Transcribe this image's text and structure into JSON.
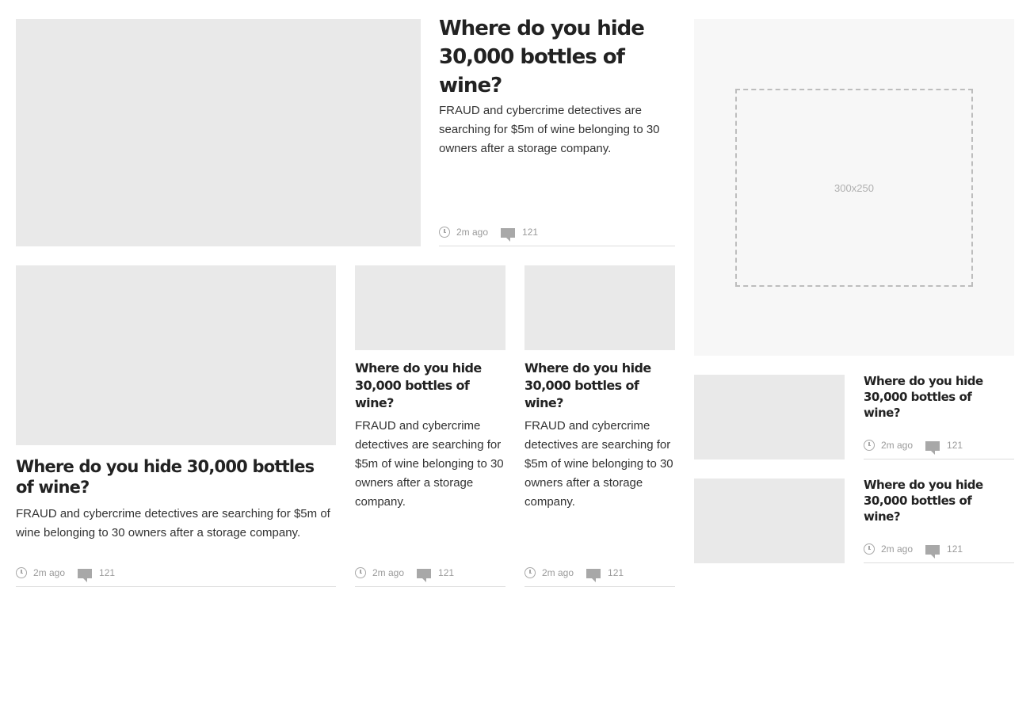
{
  "lead_story": {
    "headline": "Where do you hide 30,000 bottles of wine?",
    "standfirst": "FRAUD and cybercrime detectives are searching for $5m of wine belonging to 30 owners after a storage company.",
    "time": "2m ago",
    "comments": "121"
  },
  "feature_story": {
    "headline": "Where do you hide 30,000 bottles of wine?",
    "standfirst": "FRAUD and cybercrime detectives are searching for $5m of wine belonging to 30 owners after a storage company.",
    "time": "2m ago",
    "comments": "121"
  },
  "column_stories": [
    {
      "headline": "Where do you hide 30,000 bottles of wine?",
      "standfirst": "FRAUD and cybercrime detectives are searching for $5m of wine belonging to 30 owners after a storage company.",
      "time": "2m ago",
      "comments": "121"
    },
    {
      "headline": "Where do you hide 30,000 bottles of wine?",
      "standfirst": "FRAUD and cybercrime detectives are searching for $5m of wine belonging to 30 owners after a storage company.",
      "time": "2m ago",
      "comments": "121"
    }
  ],
  "advert": {
    "label": "300x250"
  },
  "sidebar_stories": [
    {
      "headline": "Where do you hide 30,000 bottles of wine?",
      "time": "2m ago",
      "comments": "121"
    },
    {
      "headline": "Where do you hide 30,000 bottles of wine?",
      "time": "2m ago",
      "comments": "121"
    }
  ],
  "icons": {
    "time": "clock-icon",
    "comments": "comment-icon"
  },
  "colors": {
    "placeholder": "#e9e9e9",
    "headline": "#222222",
    "meta": "#9a9a9a"
  }
}
